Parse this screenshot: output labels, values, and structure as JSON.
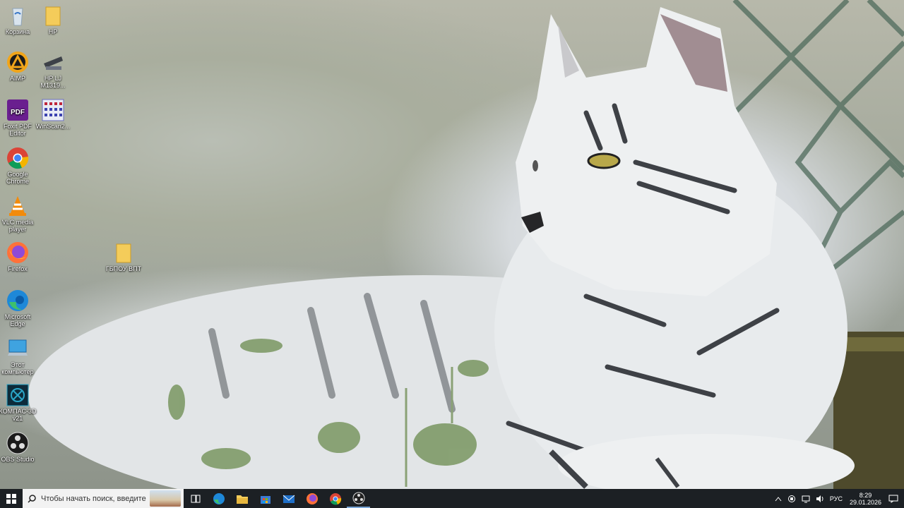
{
  "desktop": {
    "icons": [
      {
        "label": "Корзина",
        "icon": "recycle-bin-icon"
      },
      {
        "label": "HP",
        "icon": "folder-icon"
      },
      {
        "label": "AIMP",
        "icon": "aimp-icon"
      },
      {
        "label": "HP LJ M1319...",
        "icon": "scanner-icon"
      },
      {
        "label": "Foxit PDF Editor",
        "icon": "foxit-pdf-icon"
      },
      {
        "label": "WinScan2...",
        "icon": "winscan-icon"
      },
      {
        "label": "Google Chrome",
        "icon": "chrome-icon"
      },
      {
        "label": "VLC media player",
        "icon": "vlc-icon"
      },
      {
        "label": "Firefox",
        "icon": "firefox-icon"
      },
      {
        "label": "ГБПОУ ВПТ",
        "icon": "folder-icon"
      },
      {
        "label": "Microsoft Edge",
        "icon": "edge-icon"
      },
      {
        "label": "Этот компьютер",
        "icon": "this-pc-icon"
      },
      {
        "label": "КОМПАС-3D v21",
        "icon": "kompas-icon"
      },
      {
        "label": "OBS Studio",
        "icon": "obs-icon"
      }
    ]
  },
  "taskbar": {
    "search_placeholder": "Чтобы начать поиск, введите",
    "apps": [
      "task-view-icon",
      "edge-icon",
      "file-explorer-icon",
      "store-icon",
      "mail-icon",
      "firefox-icon",
      "chrome-icon",
      "obs-icon"
    ],
    "tray": {
      "language": "РУС",
      "time": "8:29",
      "date": "29.01.2026"
    }
  },
  "colors": {
    "taskbar": "#1c2024",
    "search_box": "#f2f2f2"
  }
}
